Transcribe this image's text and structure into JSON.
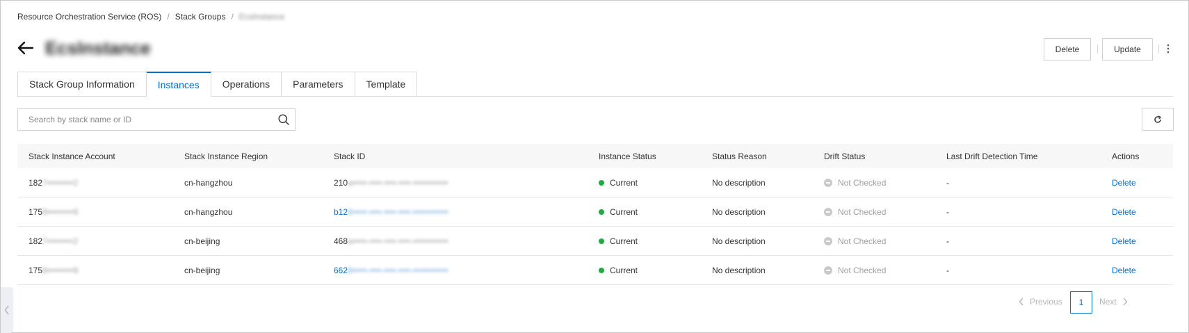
{
  "breadcrumb": {
    "items": [
      "Resource Orchestration Service (ROS)",
      "Stack Groups",
      "EcsInstance"
    ],
    "separator": "/"
  },
  "header": {
    "title": "EcsInstance",
    "delete_label": "Delete",
    "update_label": "Update"
  },
  "tabs": [
    {
      "label": "Stack Group Information",
      "active": false
    },
    {
      "label": "Instances",
      "active": true
    },
    {
      "label": "Operations",
      "active": false
    },
    {
      "label": "Parameters",
      "active": false
    },
    {
      "label": "Template",
      "active": false
    }
  ],
  "search": {
    "placeholder": "Search by stack name or ID"
  },
  "table": {
    "columns": [
      "Stack Instance Account",
      "Stack Instance Region",
      "Stack ID",
      "Instance Status",
      "Status Reason",
      "Drift Status",
      "Last Drift Detection Time",
      "Actions"
    ],
    "rows": [
      {
        "account_prefix": "182",
        "account_masked": "7•••••••••2",
        "region": "cn-hangzhou",
        "stackid_prefix": "210",
        "stackid_masked": "a•••••-••••-••••-••••-••••••••••••",
        "stackid_link": false,
        "status": "Current",
        "reason": "No description",
        "drift": "Not Checked",
        "time": "-",
        "action": "Delete"
      },
      {
        "account_prefix": "175",
        "account_masked": "8•••••••••9",
        "region": "cn-hangzhou",
        "stackid_prefix": "b12",
        "stackid_masked": "6•••••-••••-••••-••••-••••••••••••",
        "stackid_link": true,
        "status": "Current",
        "reason": "No description",
        "drift": "Not Checked",
        "time": "-",
        "action": "Delete"
      },
      {
        "account_prefix": "182",
        "account_masked": "7•••••••••2",
        "region": "cn-beijing",
        "stackid_prefix": "468",
        "stackid_masked": "a•••••-••••-••••-••••-••••••••••••",
        "stackid_link": false,
        "status": "Current",
        "reason": "No description",
        "drift": "Not Checked",
        "time": "-",
        "action": "Delete"
      },
      {
        "account_prefix": "175",
        "account_masked": "8•••••••••9",
        "region": "cn-beijing",
        "stackid_prefix": "662",
        "stackid_masked": "9•••••-••••-••••-••••-••••••••••••",
        "stackid_link": true,
        "status": "Current",
        "reason": "No description",
        "drift": "Not Checked",
        "time": "-",
        "action": "Delete"
      }
    ]
  },
  "pagination": {
    "previous_label": "Previous",
    "current_page": "1",
    "next_label": "Next"
  },
  "colors": {
    "accent": "#0070cc",
    "status_current": "#1aaf3a",
    "drift_not_checked": "#c9c9c9"
  },
  "icons": {
    "back": "arrow-left-icon",
    "more": "more-vertical-icon",
    "search": "search-icon",
    "refresh": "refresh-icon",
    "status": "status-dot-icon",
    "drift": "minus-circle-icon",
    "prev": "chevron-left-icon",
    "next": "chevron-right-icon",
    "side": "chevron-left-icon"
  }
}
